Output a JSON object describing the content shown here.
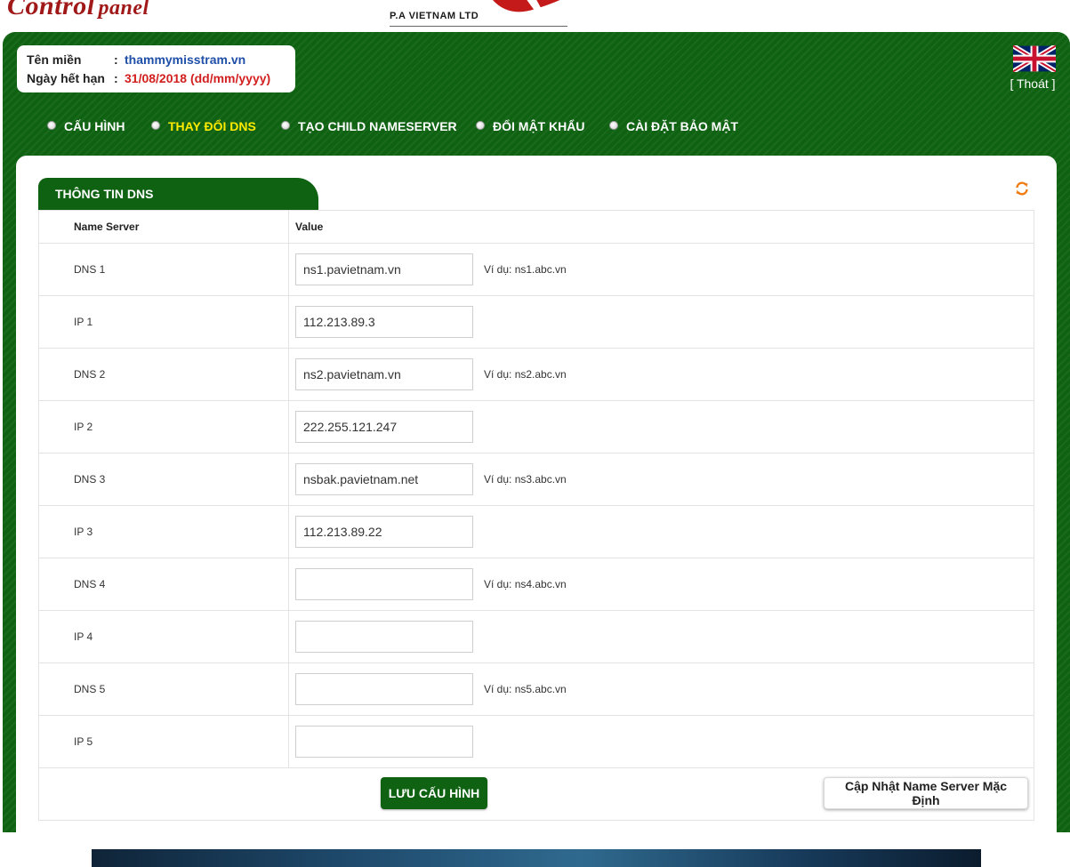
{
  "header": {
    "logo_main": "Control",
    "logo_sub": "panel",
    "company": "P.A VIETNAM LTD"
  },
  "domain_info": {
    "domain_label": "Tên miền",
    "domain_value": "thammymisstram.vn",
    "expiry_label": "Ngày hết hạn",
    "expiry_value": "31/08/2018 (dd/mm/yyyy)",
    "separator": ":"
  },
  "language_flag_icon": "uk-flag-icon",
  "logout_label": "[ Thoát ]",
  "nav": {
    "items": [
      {
        "label": "CẤU HÌNH",
        "active": false
      },
      {
        "label": "THAY ĐỔI DNS",
        "active": true
      },
      {
        "label": "TẠO CHILD NAMESERVER",
        "active": false
      },
      {
        "label": "ĐỔI MẬT KHẨU",
        "active": false
      },
      {
        "label": "CÀI ĐẶT BẢO MẬT",
        "active": false
      }
    ]
  },
  "section_title": "THÔNG TIN DNS",
  "table": {
    "headers": [
      "Name Server",
      "Value"
    ],
    "rows": [
      {
        "label": "DNS 1",
        "value": "ns1.pavietnam.vn",
        "example": "Ví dụ: ns1.abc.vn"
      },
      {
        "label": "IP 1",
        "value": "112.213.89.3",
        "example": ""
      },
      {
        "label": "DNS 2",
        "value": "ns2.pavietnam.vn",
        "example": "Ví dụ: ns2.abc.vn"
      },
      {
        "label": "IP 2",
        "value": "222.255.121.247",
        "example": ""
      },
      {
        "label": "DNS 3",
        "value": "nsbak.pavietnam.net",
        "example": "Ví dụ: ns3.abc.vn"
      },
      {
        "label": "IP 3",
        "value": "112.213.89.22",
        "example": ""
      },
      {
        "label": "DNS 4",
        "value": "",
        "example": "Ví dụ: ns4.abc.vn"
      },
      {
        "label": "IP 4",
        "value": "",
        "example": ""
      },
      {
        "label": "DNS 5",
        "value": "",
        "example": "Ví dụ: ns5.abc.vn"
      },
      {
        "label": "IP 5",
        "value": "",
        "example": ""
      }
    ]
  },
  "buttons": {
    "save": "LƯU CẤU HÌNH",
    "default_ns": "Cập Nhật Name Server Mặc Định"
  },
  "colors": {
    "panel_green": "#0f6212",
    "active_nav": "#ffea00",
    "domain_blue": "#1f4fa8",
    "expiry_red": "#d21f1f",
    "logo_red": "#a01818"
  }
}
